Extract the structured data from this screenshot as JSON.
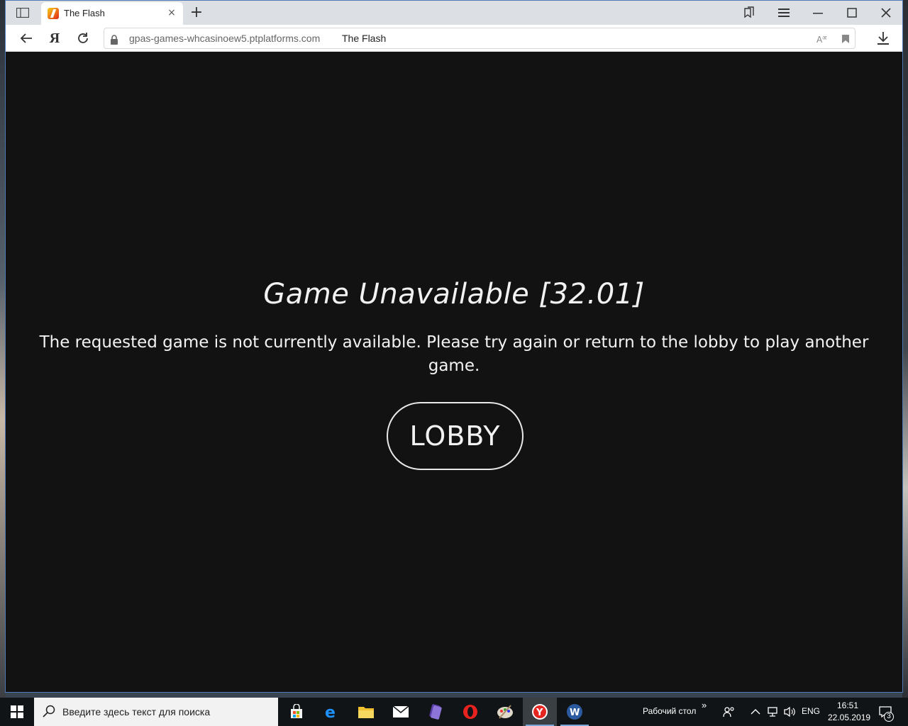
{
  "browser": {
    "tab_title": "The Flash",
    "close_tab_glyph": "×",
    "new_tab_glyph": "+",
    "url": "gpas-games-whcasinoew5.ptplatforms.com",
    "page_title": "The Flash",
    "yandex_glyph": "Я"
  },
  "page": {
    "error_title": "Game Unavailable [32.01]",
    "error_message": "The requested game is not currently available. Please try again or return to the lobby to play another game.",
    "lobby_label": "LOBBY"
  },
  "taskbar": {
    "search_placeholder": "Введите здесь текст для поиска",
    "desktop_label": "Рабочий стол",
    "chevron_glyph": "»",
    "language": "ENG",
    "time": "16:51",
    "date": "22.05.2019",
    "notifications_count": "3"
  },
  "colors": {
    "page_background": "#121212",
    "text": "#f2f2f2",
    "taskbar": "#101417",
    "tab_strip": "#dcdfe4"
  }
}
